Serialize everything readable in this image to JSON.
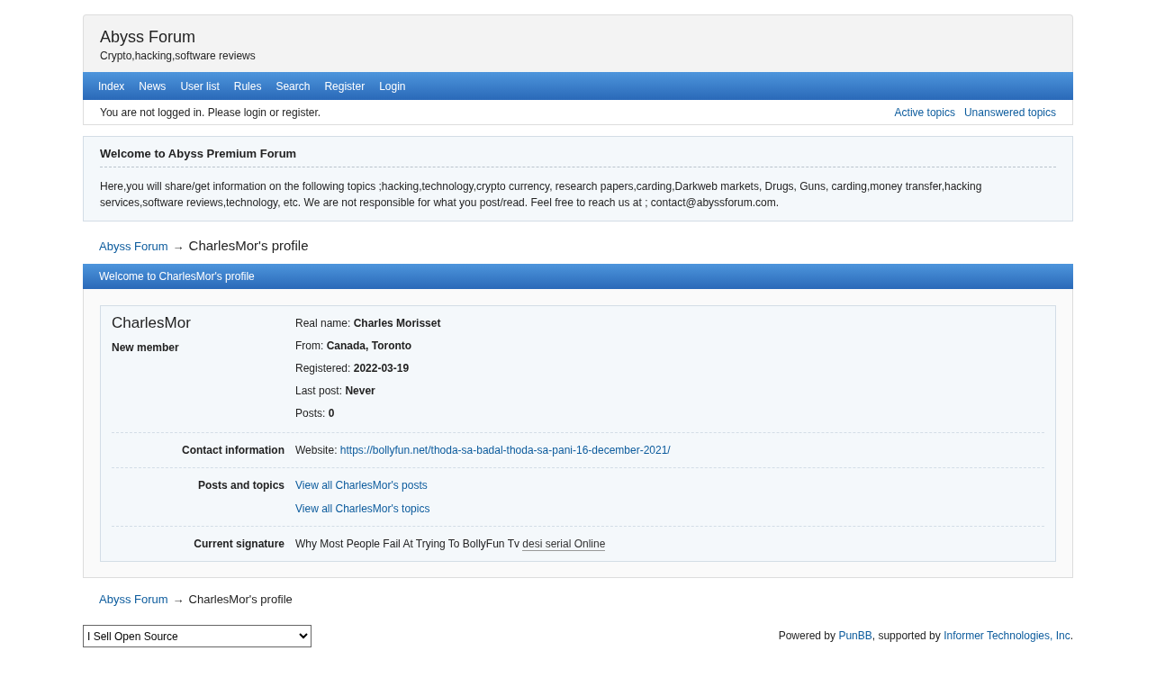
{
  "header": {
    "title": "Abyss Forum",
    "subtitle": "Crypto,hacking,software reviews"
  },
  "nav": [
    {
      "label": "Index"
    },
    {
      "label": "News"
    },
    {
      "label": "User list"
    },
    {
      "label": "Rules"
    },
    {
      "label": "Search"
    },
    {
      "label": "Register"
    },
    {
      "label": "Login"
    }
  ],
  "status": {
    "message": "You are not logged in. Please login or register.",
    "links": [
      "Active topics",
      "Unanswered topics"
    ]
  },
  "announcement": {
    "title": "Welcome to Abyss Premium Forum",
    "body": "Here,you will share/get information on the following topics ;hacking,technology,crypto currency, research papers,carding,Darkweb markets, Drugs, Guns, carding,money transfer,hacking services,software reviews,technology, etc. We are not responsible for what you post/read. Feel free to reach us at ; contact@abyssforum.com."
  },
  "breadcrumb_top": {
    "link": "Abyss Forum",
    "separator": "→",
    "current": "CharlesMor's profile"
  },
  "profile": {
    "heading": "Welcome to CharlesMor's profile",
    "username": "CharlesMor",
    "user_title": "New member",
    "fields": [
      "Real name: **Charles Morisset**",
      "From: **Canada, Toronto**",
      "Registered: **2022-03-19**",
      "Last post: **Never**",
      "Posts: **0**"
    ],
    "sections": [
      {
        "label": "Contact information",
        "items": [
          {
            "prefix": "Website: ",
            "link": "https://bollyfun.net/thoda-sa-badal-thoda-sa-pani-16-december-2021/"
          }
        ]
      },
      {
        "label": "Posts and topics",
        "items": [
          {
            "link": "View all CharlesMor's posts"
          },
          {
            "link": "View all CharlesMor's topics"
          }
        ]
      },
      {
        "label": "Current signature",
        "items": [
          {
            "prefix": "Why Most People Fail At Trying To BollyFun Tv ",
            "link": "desi serial Online",
            "kind": "signature"
          }
        ]
      }
    ]
  },
  "breadcrumb_bottom": {
    "link": "Abyss Forum",
    "separator": "→",
    "current": "CharlesMor's profile"
  },
  "footer": {
    "select": "I Sell Open Source",
    "powered": [
      {
        "text": "Powered by "
      },
      {
        "link": "PunBB"
      },
      {
        "text": ", supported by "
      },
      {
        "link": "Informer Technologies, Inc"
      },
      {
        "text": "."
      }
    ]
  }
}
